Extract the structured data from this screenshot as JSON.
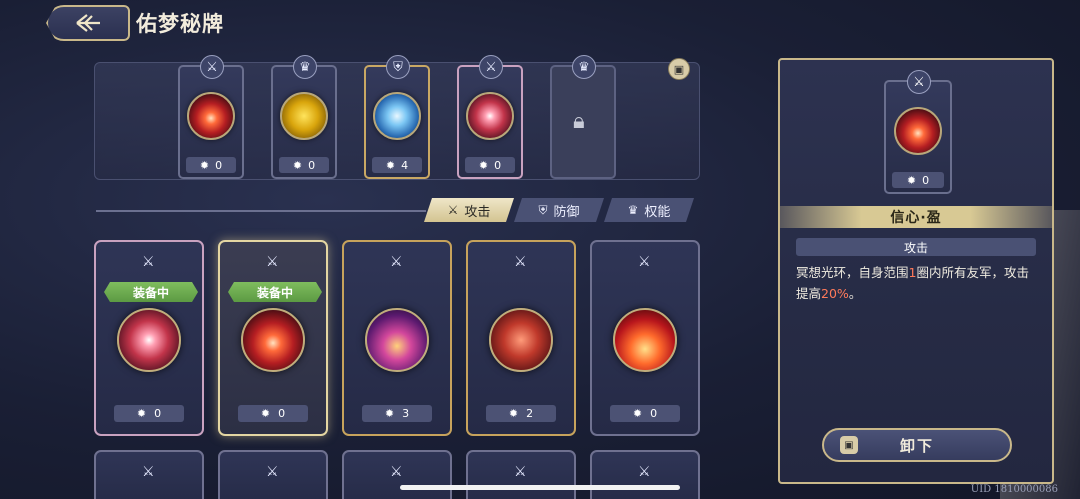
{
  "header": {
    "title": "佑梦秘牌"
  },
  "loadout": {
    "slots": [
      {
        "type_icon": "sword-icon",
        "count": "0",
        "art": "art-red",
        "frame": "silver"
      },
      {
        "type_icon": "crown-icon",
        "count": "0",
        "art": "art-gold",
        "frame": "silver"
      },
      {
        "type_icon": "shield-icon",
        "count": "4",
        "art": "art-ice",
        "frame": "gold"
      },
      {
        "type_icon": "sword-icon",
        "count": "0",
        "art": "art-burst",
        "frame": "pink"
      },
      {
        "type_icon": "crown-icon",
        "locked": true
      }
    ]
  },
  "tabs": [
    {
      "label": "攻击",
      "icon": "sword-icon",
      "active": true
    },
    {
      "label": "防御",
      "icon": "shield-icon",
      "active": false
    },
    {
      "label": "权能",
      "icon": "crown-icon",
      "active": false
    }
  ],
  "cards": [
    {
      "count": "0",
      "equipped": "装备中",
      "art": "art-burst",
      "frame": "pink"
    },
    {
      "count": "0",
      "equipped": "装备中",
      "art": "art-red",
      "frame": "selected"
    },
    {
      "count": "3",
      "equipped": "",
      "art": "art-purple",
      "frame": "gold"
    },
    {
      "count": "2",
      "equipped": "",
      "art": "art-slash",
      "frame": "gold"
    },
    {
      "count": "0",
      "equipped": "",
      "art": "art-fire",
      "frame": "silver"
    }
  ],
  "detail": {
    "count": "0",
    "name": "信心·盈",
    "type": "攻击",
    "desc_pre": "冥想光环，自身范围",
    "desc_hl1": "1",
    "desc_mid": "圈内所有友军，攻击提高",
    "desc_hl2": "20%",
    "desc_post": "。",
    "button_label": "卸下"
  },
  "uid": "UID 1810000086",
  "colors": {
    "accent_gold": "#c9b88a",
    "equipped_green": "#6aa94c",
    "highlight_red": "#ff7a5a"
  }
}
